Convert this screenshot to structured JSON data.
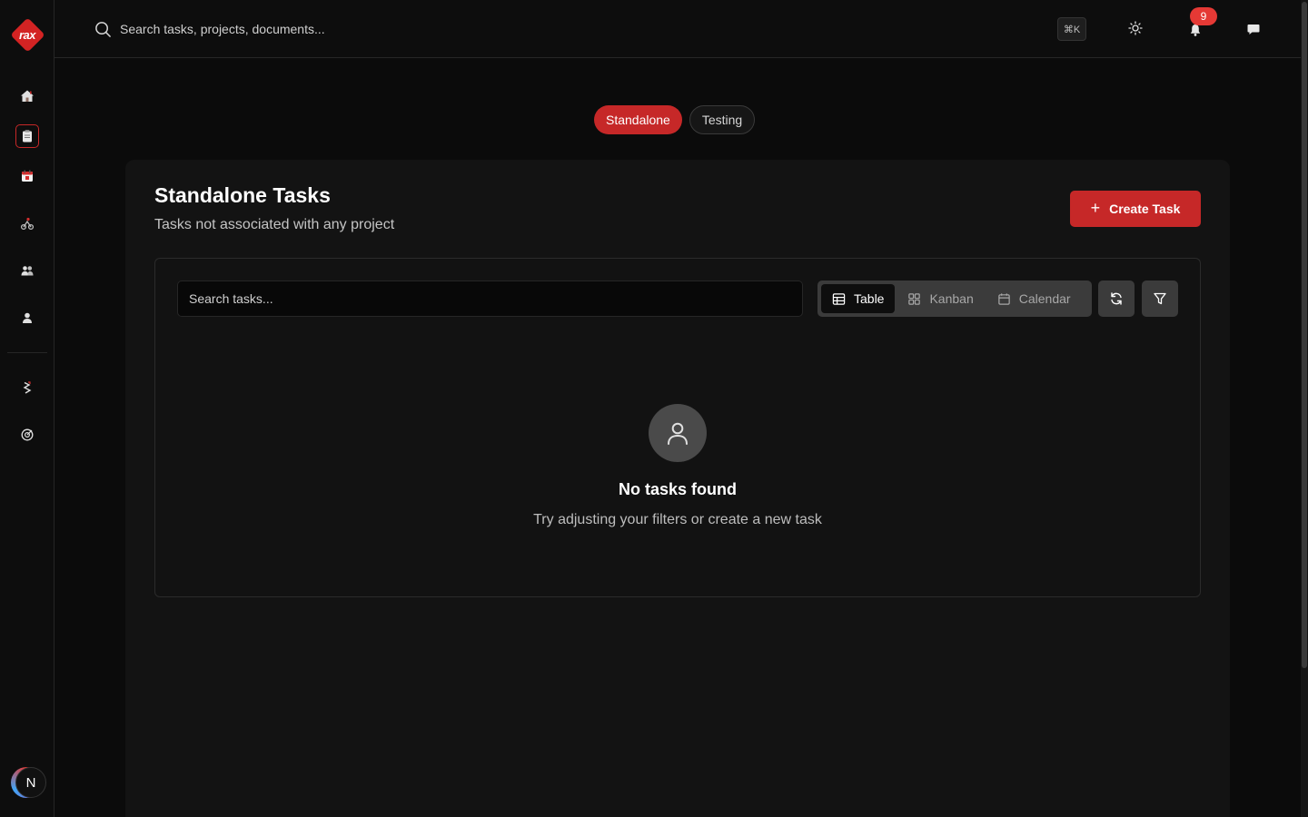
{
  "brand": {
    "logo_text": "rax"
  },
  "colors": {
    "accent": "#c62828",
    "background": "#0b0b0b",
    "card": "#131313",
    "badge": "#e53935"
  },
  "sidebar": {
    "items": [
      {
        "icon": "home-icon",
        "active": false
      },
      {
        "icon": "clipboard-icon",
        "active": true
      },
      {
        "icon": "calendar-icon",
        "active": false
      },
      {
        "icon": "workflow-icon",
        "active": false
      },
      {
        "icon": "team-icon",
        "active": false
      },
      {
        "icon": "user-icon",
        "active": false
      },
      {
        "icon": "integration-icon",
        "active": false
      },
      {
        "icon": "goal-icon",
        "active": false
      }
    ],
    "avatar_initial": "N"
  },
  "topbar": {
    "search_placeholder": "Search tasks, projects, documents...",
    "shortcut": "⌘K",
    "notification_count": "9"
  },
  "tabs": [
    {
      "label": "Standalone",
      "active": true
    },
    {
      "label": "Testing",
      "active": false
    }
  ],
  "main": {
    "title": "Standalone Tasks",
    "subtitle": "Tasks not associated with any project",
    "create_button": "Create Task",
    "search_placeholder": "Search tasks...",
    "views": [
      {
        "label": "Table",
        "icon": "table-icon",
        "active": true
      },
      {
        "label": "Kanban",
        "icon": "kanban-icon",
        "active": false
      },
      {
        "label": "Calendar",
        "icon": "calendar-icon",
        "active": false
      }
    ],
    "empty_state": {
      "title": "No tasks found",
      "message": "Try adjusting your filters or create a new task"
    }
  }
}
